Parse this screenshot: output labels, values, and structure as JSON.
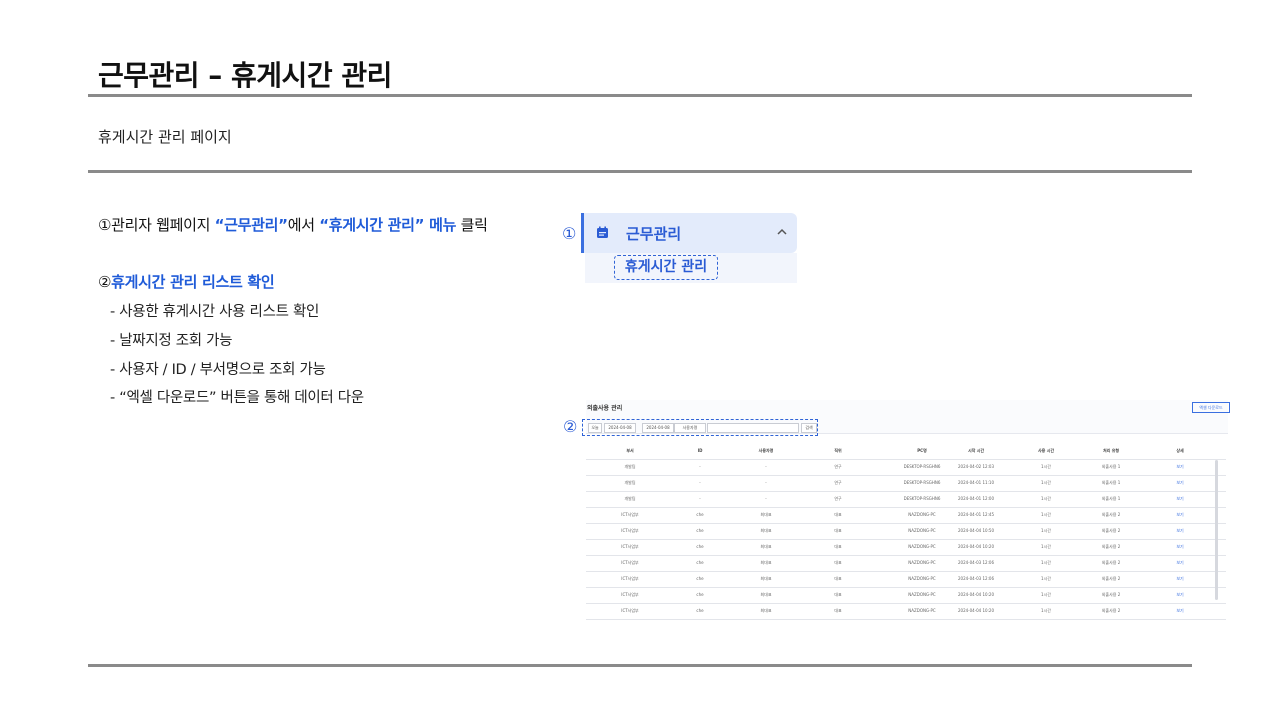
{
  "slide": {
    "title": "근무관리 – 휴게시간 관리",
    "subtitle": "휴게시간 관리 페이지"
  },
  "steps": {
    "step1": {
      "num": "①",
      "pre": "관리자 웹페이지 ",
      "hl1": "“근무관리”",
      "mid": "에서 ",
      "hl2": "“휴게시간 관리” 메뉴",
      "post": " 클릭"
    },
    "step2": {
      "num": "②",
      "hl": "휴게시간 관리 리스트 확인",
      "bullets": [
        "- 사용한 휴게시간 사용 리스트 확인",
        "- 날짜지정 조회 가능",
        "- 사용자 / ID / 부서명으로 조회 가능",
        "- “엑셀 다운로드” 버튼을 통해 데이터 다운"
      ]
    }
  },
  "menu": {
    "marker": "①",
    "parent_label": "근무관리",
    "child_label": "휴게시간 관리",
    "icons": [
      "calendar-icon",
      "chevron-up-icon"
    ],
    "accent": "#2a5bd4"
  },
  "screenshot": {
    "marker": "②",
    "title": "외출사용 관리",
    "excel_button": "엑셀 다운로드",
    "filters": [
      "오늘",
      "2024-04-08",
      "2024-04-08",
      "사용자명",
      "",
      "검색"
    ],
    "columns": [
      "부서",
      "ID",
      "사용자명",
      "직위",
      "PC명",
      "시작 시간",
      "사용 시간",
      "처리 유형",
      "상세"
    ],
    "rows": [
      [
        "개발팀",
        "-",
        "-",
        "연구",
        "DESKTOP-RSGHN6",
        "2024-04-02 12:03",
        "1시간",
        "외출사용 1",
        "보기"
      ],
      [
        "개발팀",
        "-",
        "-",
        "연구",
        "DESKTOP-RSGHN6",
        "2024-04-01 11:10",
        "1시간",
        "외출사용 1",
        "보기"
      ],
      [
        "개발팀",
        "-",
        "-",
        "연구",
        "DESKTOP-RSGHN6",
        "2024-04-01 12:00",
        "1시간",
        "외출사용 1",
        "보기"
      ],
      [
        "ICT사업부",
        "che",
        "최대표",
        "대표",
        "NAZDONG-PC",
        "2024-04-01 12:45",
        "1시간",
        "외출사용 2",
        "보기"
      ],
      [
        "ICT사업부",
        "che",
        "최대표",
        "대표",
        "NAZDONG-PC",
        "2024-04-04 10:50",
        "1시간",
        "외출사용 2",
        "보기"
      ],
      [
        "ICT사업부",
        "che",
        "최대표",
        "대표",
        "NAZDONG-PC",
        "2024-04-04 10:20",
        "1시간",
        "외출사용 2",
        "보기"
      ],
      [
        "ICT사업부",
        "che",
        "최대표",
        "대표",
        "NAZDONG-PC",
        "2024-04-03 12:06",
        "1시간",
        "외출사용 2",
        "보기"
      ],
      [
        "ICT사업부",
        "che",
        "최대표",
        "대표",
        "NAZDONG-PC",
        "2024-04-03 12:06",
        "1시간",
        "외출사용 2",
        "보기"
      ],
      [
        "ICT사업부",
        "che",
        "최대표",
        "대표",
        "NAZDONG-PC",
        "2024-04-04 10:20",
        "1시간",
        "외출사용 2",
        "보기"
      ],
      [
        "ICT사업부",
        "che",
        "최대표",
        "대표",
        "NAZDONG-PC",
        "2024-04-04 10:20",
        "1시간",
        "외출사용 2",
        "보기"
      ]
    ]
  }
}
